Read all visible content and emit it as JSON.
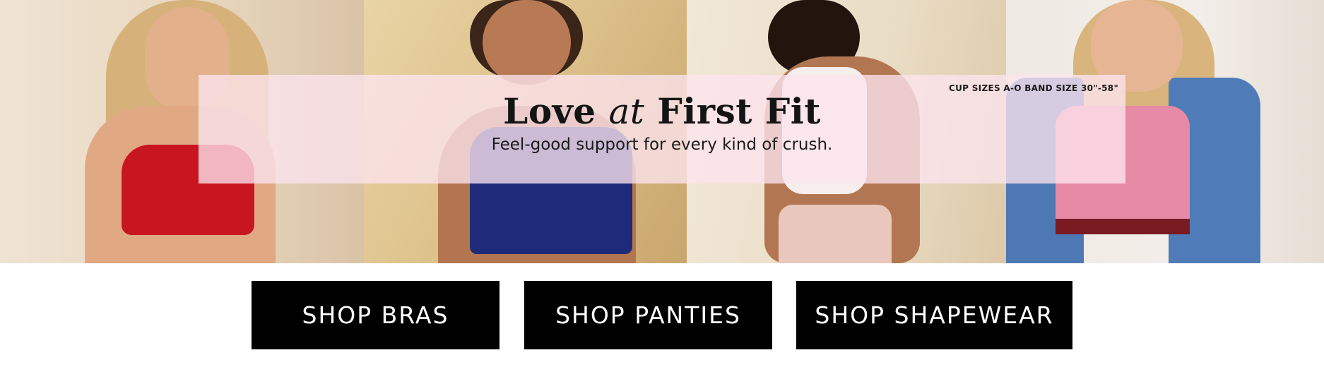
{
  "banner": {
    "headline_part1": "Love ",
    "headline_part2": "at",
    "headline_part3": " First Fit",
    "subheadline": "Feel-good support for every kind of crush.",
    "size_note": "CUP SIZES A-O BAND SIZE 30\"-58\""
  },
  "buttons": {
    "bras": "SHOP BRAS",
    "panties": "SHOP PANTIES",
    "shapewear": "SHOP SHAPEWEAR"
  },
  "colors": {
    "overlay": "#fce4ee",
    "button_bg": "#000000",
    "button_text": "#ffffff"
  }
}
